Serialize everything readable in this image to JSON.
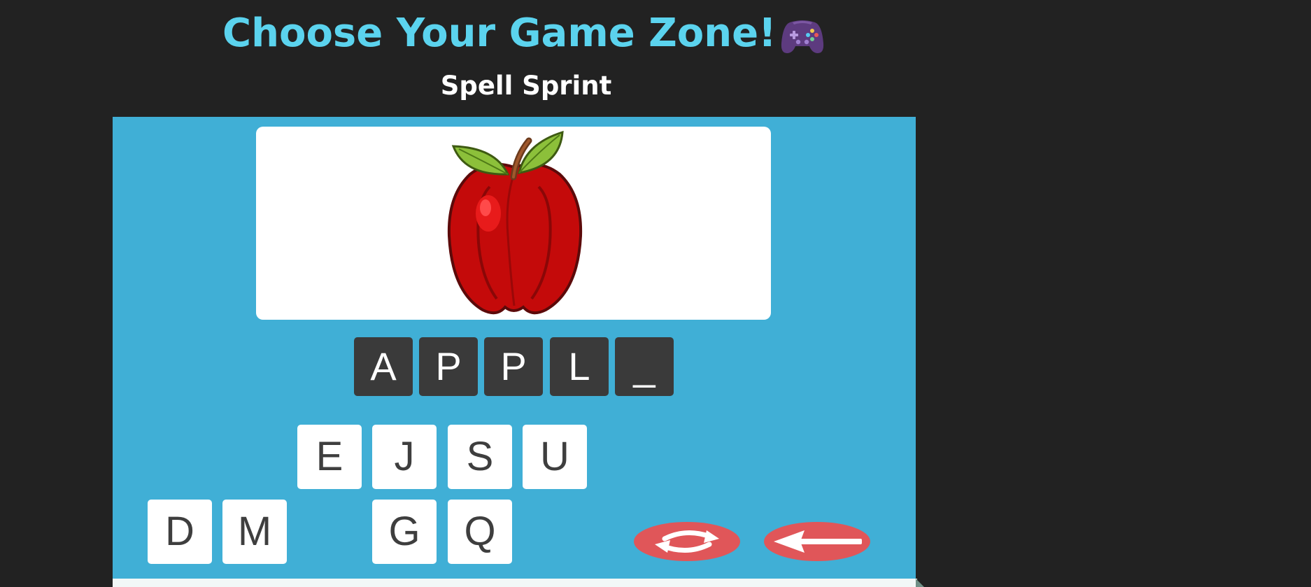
{
  "header": {
    "title": "Choose Your Game Zone!",
    "title_color": "#5bd3ee",
    "icon": "game-controller-icon",
    "game_name": "Spell Sprint"
  },
  "game": {
    "picture": "apple",
    "answer_slots": [
      "A",
      "P",
      "P",
      "L",
      "_"
    ],
    "letter_tiles_row1": [
      "E",
      "J",
      "S",
      "U"
    ],
    "letter_tiles_row2": [
      "D",
      "M",
      "G",
      "Q"
    ],
    "actions": [
      "refresh-icon",
      "backspace-arrow-icon"
    ],
    "colors": {
      "panel": "#40afd6",
      "slot": "#3a3a3a",
      "tile": "#ffffff",
      "action": "#e05659"
    }
  }
}
